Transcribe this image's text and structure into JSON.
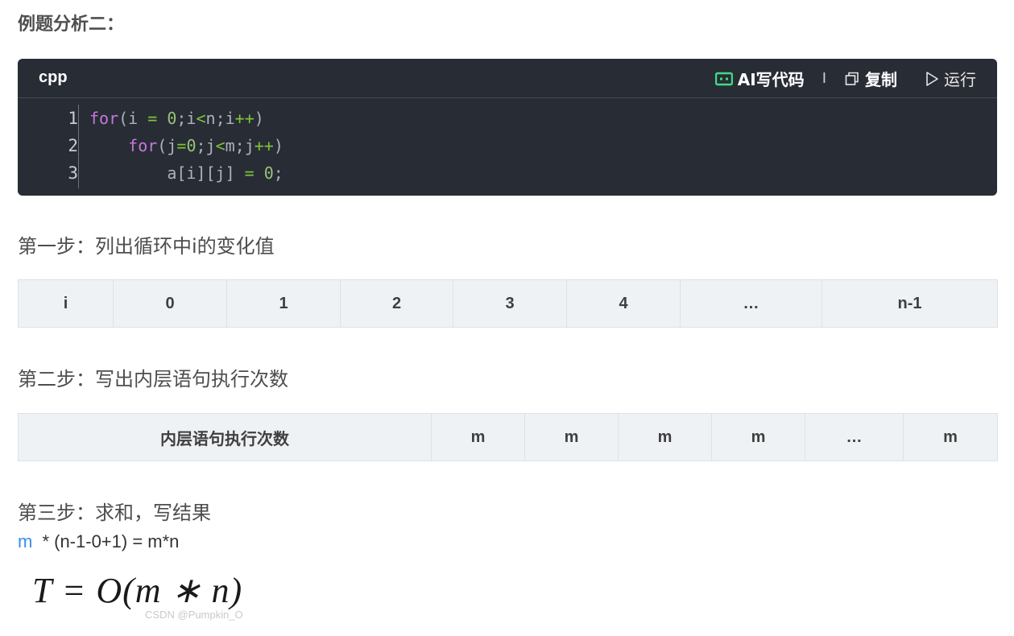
{
  "heading": "例题分析二：",
  "code": {
    "lang": "cpp",
    "tools": {
      "ai": "AI写代码",
      "sep": "I",
      "copy": "复制",
      "run": "运行"
    },
    "line_numbers": [
      "1",
      "2",
      "3"
    ],
    "lines": [
      [
        [
          "kw",
          "for"
        ],
        [
          "p",
          "(i "
        ],
        [
          "op",
          "="
        ],
        [
          "p",
          " "
        ],
        [
          "num",
          "0"
        ],
        [
          "p",
          ";i"
        ],
        [
          "op",
          "<"
        ],
        [
          "p",
          "n;i"
        ],
        [
          "op",
          "++"
        ],
        [
          "p",
          ")"
        ]
      ],
      [
        [
          "p",
          "    "
        ],
        [
          "kw",
          "for"
        ],
        [
          "p",
          "(j"
        ],
        [
          "op",
          "="
        ],
        [
          "num",
          "0"
        ],
        [
          "p",
          ";j"
        ],
        [
          "op",
          "<"
        ],
        [
          "p",
          "m;j"
        ],
        [
          "op",
          "++"
        ],
        [
          "p",
          ")"
        ]
      ],
      [
        [
          "p",
          "        a[i][j] "
        ],
        [
          "op",
          "="
        ],
        [
          "p",
          " "
        ],
        [
          "num",
          "0"
        ],
        [
          "p",
          ";"
        ]
      ]
    ]
  },
  "step1": "第一步：列出循环中i的变化值",
  "table1": [
    "i",
    "0",
    "1",
    "2",
    "3",
    "4",
    "…",
    "n-1"
  ],
  "step2": "第二步：写出内层语句执行次数",
  "table2": [
    "内层语句执行次数",
    "m",
    "m",
    "m",
    "m",
    "…",
    "m"
  ],
  "step3": "第三步：求和，写结果",
  "formula": {
    "m": "m",
    "rest": " * (n-1-0+1) = m*n"
  },
  "equation": "T = O(m ∗ n)",
  "watermark": "CSDN @Pumpkin_O",
  "colors": {
    "code_bg": "#282c34",
    "keyword": "#c678dd",
    "operator": "#7ec23c",
    "number": "#98c379",
    "ai_icon": "#3ddc84",
    "link_blue": "#3b8fe8"
  }
}
